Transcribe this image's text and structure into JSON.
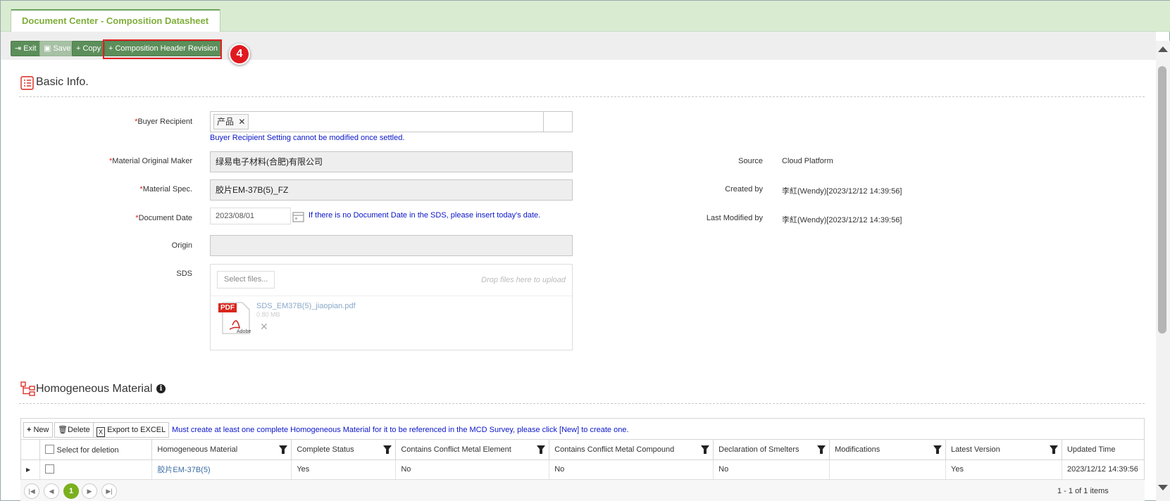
{
  "tab": {
    "title": "Document Center - Composition Datasheet"
  },
  "toolbar": {
    "exit_label": "Exit",
    "save_label": "Save",
    "copy_label": "Copy",
    "revision_label": "Composition Header Revision",
    "step_badge": "4"
  },
  "basic_info": {
    "title": "Basic Info.",
    "buyer_recipient": {
      "label": "Buyer Recipient",
      "tag": "产品",
      "note": "Buyer Recipient Setting cannot be modified once settled."
    },
    "material_maker": {
      "label": "Material Original Maker",
      "value": "绿易电子材料(合肥)有限公司"
    },
    "material_spec": {
      "label": "Material Spec.",
      "value": "胶片EM-37B(5)_FZ"
    },
    "document_date": {
      "label": "Document Date",
      "value": "2023/08/01",
      "note": "If there is no Document Date in the SDS, please insert today's date."
    },
    "origin": {
      "label": "Origin",
      "value": ""
    },
    "sds": {
      "label": "SDS",
      "select_label": "Select files...",
      "drop_hint": "Drop files here to upload",
      "file_name": "SDS_EM37B(5)_jiaopian.pdf",
      "file_size": "0.80 MB",
      "file_type": "PDF"
    },
    "source": {
      "label": "Source",
      "value": "Cloud Platform"
    },
    "created_by": {
      "label": "Created by",
      "value": "李紅(Wendy)[2023/12/12 14:39:56]"
    },
    "last_modified_by": {
      "label": "Last Modified by",
      "value": "李紅(Wendy)[2023/12/12 14:39:56]"
    }
  },
  "homogeneous": {
    "title": "Homogeneous Material",
    "new_label": "New",
    "delete_label": "Delete",
    "export_label": "Export to EXCEL",
    "note": "Must create at least one complete Homogeneous Material for it to be referenced in the MCD Survey, please click [New] to create one.",
    "columns": [
      "Select for deletion",
      "Homogeneous Material",
      "Complete Status",
      "Contains Conflict Metal Element",
      "Contains Conflict Metal Compound",
      "Declaration of Smelters",
      "Modifications",
      "Latest Version",
      "Updated Time"
    ],
    "rows": [
      {
        "material": "胶片EM-37B(5)",
        "complete": "Yes",
        "element": "No",
        "compound": "No",
        "smelters": "No",
        "modifications": "",
        "latest": "Yes",
        "updated": "2023/12/12 14:39:56"
      }
    ],
    "pager": {
      "current": "1",
      "summary": "1 - 1 of 1 items"
    }
  }
}
